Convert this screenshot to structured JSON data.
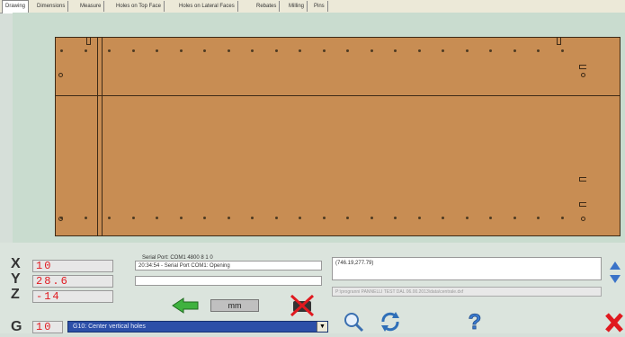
{
  "tabs": [
    {
      "label": "Drawing"
    },
    {
      "label": "Dimensions"
    },
    {
      "label": "Measure"
    },
    {
      "label": "Holes on Top Face"
    },
    {
      "label": "Holes on Lateral Faces"
    },
    {
      "label": "Rebates"
    },
    {
      "label": "Milling"
    },
    {
      "label": "Pins"
    }
  ],
  "axes": {
    "x": {
      "letter": "X",
      "value": "10"
    },
    "y": {
      "letter": "Y",
      "value": "28.6"
    },
    "z": {
      "letter": "Z",
      "value": "-14"
    },
    "g": {
      "letter": "G",
      "value": "10"
    }
  },
  "serial": {
    "label": "Serial Port: COM1 4800 8 1 0",
    "log": "20:34:54 - Serial Port COM1: Opening"
  },
  "coordinates": "(746.19,277.79)",
  "file_path": "P:\\progranni PANNELLI TEST DAL 06.00.2013\\data\\centrale.dxf",
  "unit_label": "mm",
  "gcode_select": "G10: Center vertical holes",
  "colors": {
    "panel": "#c88d53",
    "canvas": "#c9dccf",
    "axis_value": "#e0191f",
    "combo": "#2c4fa8"
  }
}
